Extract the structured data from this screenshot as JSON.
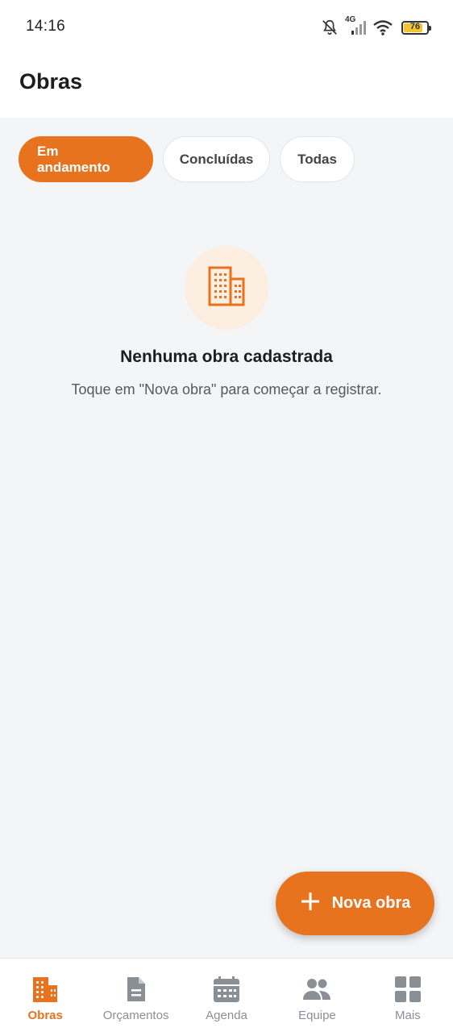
{
  "status_bar": {
    "time": "14:16",
    "network": "4G",
    "battery": "76",
    "battery_level": 0.76,
    "icons": [
      "bell-muted-icon",
      "signal-icon",
      "wifi-icon",
      "battery-icon"
    ]
  },
  "header": {
    "title": "Obras"
  },
  "filters": {
    "items": [
      {
        "label": "Em andamento",
        "active": true
      },
      {
        "label": "Concluídas",
        "active": false
      },
      {
        "label": "Todas",
        "active": false
      }
    ]
  },
  "empty_state": {
    "icon": "building-icon",
    "title": "Nenhuma obra cadastrada",
    "subtitle": "Toque em \"Nova obra\" para começar a registrar."
  },
  "fab": {
    "icon": "plus-icon",
    "label": "Nova obra"
  },
  "bottom_nav": {
    "items": [
      {
        "label": "Obras",
        "icon": "building-icon",
        "active": true
      },
      {
        "label": "Orçamentos",
        "icon": "document-icon",
        "active": false
      },
      {
        "label": "Agenda",
        "icon": "calendar-icon",
        "active": false
      },
      {
        "label": "Equipe",
        "icon": "people-icon",
        "active": false
      },
      {
        "label": "Mais",
        "icon": "grid-icon",
        "active": false
      }
    ]
  },
  "colors": {
    "accent": "#e8731f",
    "accent_soft": "#fdeee2",
    "background": "#f3f5f7",
    "nav_inactive": "#8a8f96"
  }
}
